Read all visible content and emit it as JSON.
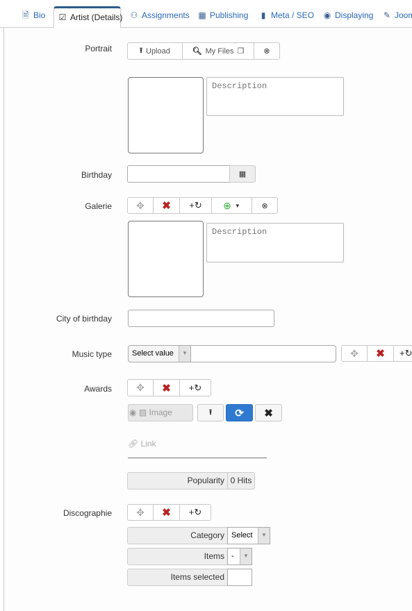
{
  "tabs": [
    {
      "label": "Bio",
      "icon": "document-icon"
    },
    {
      "label": "Artist (Details)",
      "icon": "clipboard-check-icon",
      "active": true
    },
    {
      "label": "Assignments",
      "icon": "sitemap-icon"
    },
    {
      "label": "Publishing",
      "icon": "calendar-icon"
    },
    {
      "label": "Meta / SEO",
      "icon": "bookmark-icon"
    },
    {
      "label": "Displaying",
      "icon": "eye-icon"
    },
    {
      "label": "Joom",
      "icon": "pencil-icon"
    }
  ],
  "portrait": {
    "label": "Portrait",
    "upload": "Upload",
    "my_files": "My Files",
    "description_placeholder": "Description"
  },
  "birthday": {
    "label": "Birthday",
    "value": ""
  },
  "galerie": {
    "label": "Galerie",
    "description_placeholder": "Description"
  },
  "city": {
    "label": "City of birthday",
    "value": ""
  },
  "music": {
    "label": "Music type",
    "select": "Select value"
  },
  "awards": {
    "label": "Awards",
    "image_placeholder": "Image",
    "link_placeholder": "Link",
    "popularity_label": "Popularity",
    "popularity_value": "0 Hits"
  },
  "disco": {
    "label": "Discographie",
    "category_label": "Category",
    "category_value": "Select",
    "items_label": "Items",
    "items_value": "-",
    "items_selected_label": "Items selected"
  },
  "colors": {
    "accent": "#2d5b8a",
    "primary_button": "#2f7ad0",
    "danger": "#b22222"
  }
}
